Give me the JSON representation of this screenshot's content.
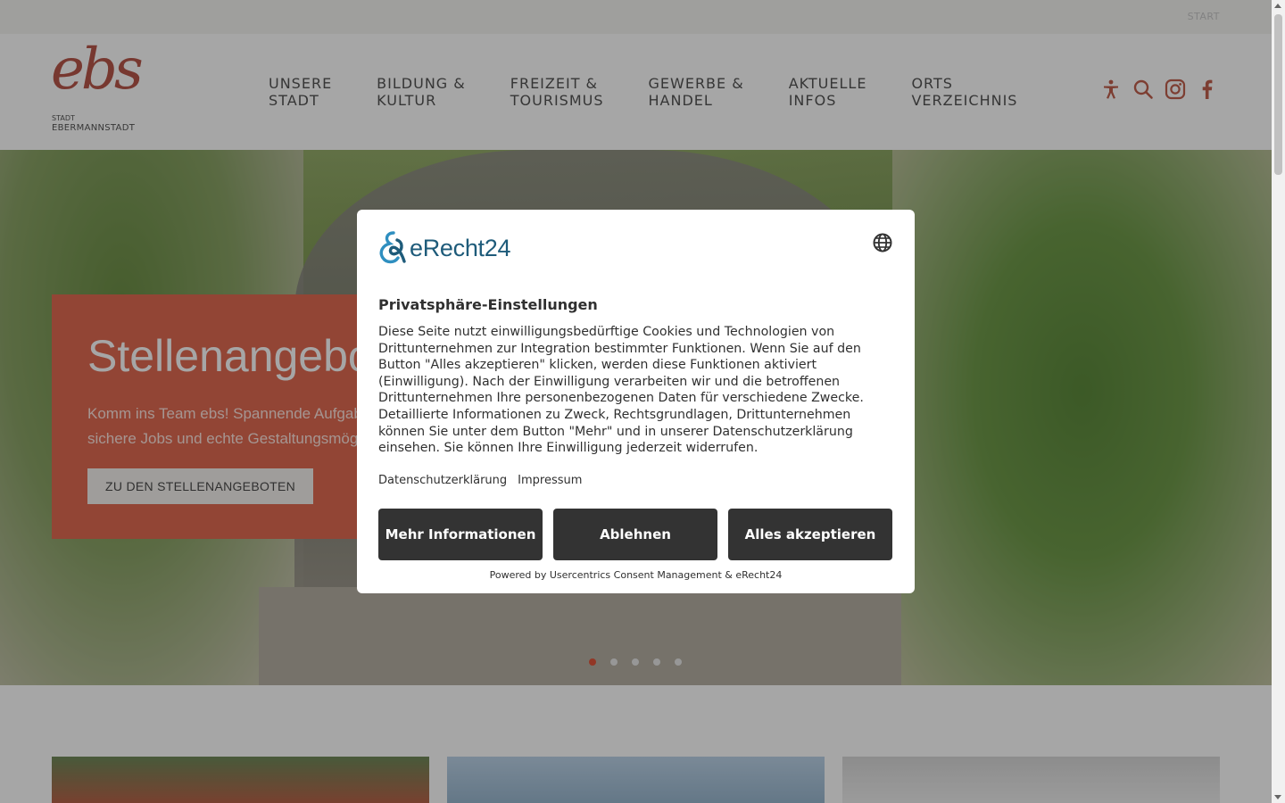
{
  "topbar": {
    "start_label": "START"
  },
  "logo": {
    "mark": "ebs",
    "line1": "STADT",
    "line2": "EBERMANNSTADT"
  },
  "nav": {
    "items": [
      {
        "label": "UNSERE\nSTADT"
      },
      {
        "label": "BILDUNG &\nKULTUR"
      },
      {
        "label": "FREIZEIT &\nTOURISMUS"
      },
      {
        "label": "GEWERBE &\nHANDEL"
      },
      {
        "label": "AKTUELLE\nINFOS"
      },
      {
        "label": "ORTS\nVERZEICHNIS"
      }
    ],
    "icons": [
      "accessibility-icon",
      "search-icon",
      "instagram-icon",
      "facebook-icon"
    ],
    "accent_color": "#c0604d"
  },
  "hero": {
    "title": "Stellenangebote",
    "text_line1": "Komm ins Team ebs! Spannende Aufgaben,",
    "text_line2": "sichere Jobs und echte Gestaltungsmöglichkeiten",
    "cta": "ZU DEN STELLENANGEBOTEN",
    "card_color": "#e06a52",
    "slides_total": 5,
    "active_slide": 1
  },
  "consent": {
    "brand": "eRecht24",
    "title": "Privatsphäre-Einstellungen",
    "description": "Diese Seite nutzt einwilligungsbedürftige Cookies und Technologien von Drittunternehmen zur Integration bestimmter Funktionen. Wenn Sie auf den Button \"Alles akzeptieren\" klicken, werden diese Funktionen aktiviert (Einwilligung). Nach der Einwilligung verarbeiten wir und die betroffenen Drittunternehmen Ihre personenbezogenen Daten für verschiedene Zwecke. Detaillierte Informationen zu Zweck, Rechtsgrundlagen, Drittunternehmen können Sie unter dem Button \"Mehr\" und in unserer Datenschutzerklärung einsehen. Sie können Ihre Einwilligung jederzeit widerrufen.",
    "link_privacy": "Datenschutzerklärung",
    "link_imprint": "Impressum",
    "btn_more": "Mehr Informationen",
    "btn_decline": "Ablehnen",
    "btn_accept": "Alles akzeptieren",
    "powered_by": "Powered by Usercentrics Consent Management & eRecht24",
    "brand_color": "#1e5b7a",
    "button_color": "#333333"
  }
}
